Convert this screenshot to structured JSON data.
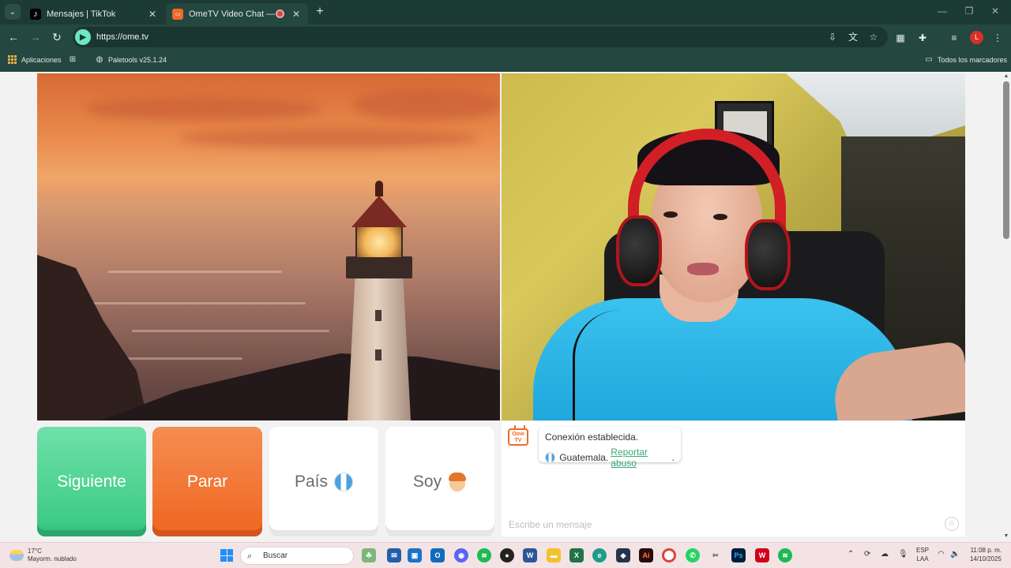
{
  "browser": {
    "tabs": [
      {
        "title": "Mensajes | TikTok",
        "active": false
      },
      {
        "title": "OmeTV Video Chat — Omegl",
        "active": true
      }
    ],
    "url": "https://ome.tv",
    "profile_initial": "L",
    "bookmarks": {
      "apps": "Aplicaciones",
      "paletools": "Paletools v25.1.24",
      "all": "Todos los marcadores"
    }
  },
  "controls": {
    "next": "Siguiente",
    "stop": "Parar",
    "country": "País",
    "gender": "Soy"
  },
  "chat": {
    "status": "Conexión establecida.",
    "country": "Guatemala.",
    "report": "Reportar abuso",
    "report_suffix": ".",
    "placeholder": "Escribe un mensaje",
    "logo_text": "Ome TV"
  },
  "taskbar": {
    "temperature": "17°C",
    "weather": "Mayorm. nublado",
    "search": "Buscar",
    "lang_top": "ESP",
    "lang_bottom": "LAA",
    "time": "11:08 p. m.",
    "date": "14/10/2025"
  },
  "colors": {
    "browser_frame": "#1c3b34",
    "next_button": "#3ecb85",
    "stop_button": "#f06a25",
    "report_link": "#3aa878"
  }
}
